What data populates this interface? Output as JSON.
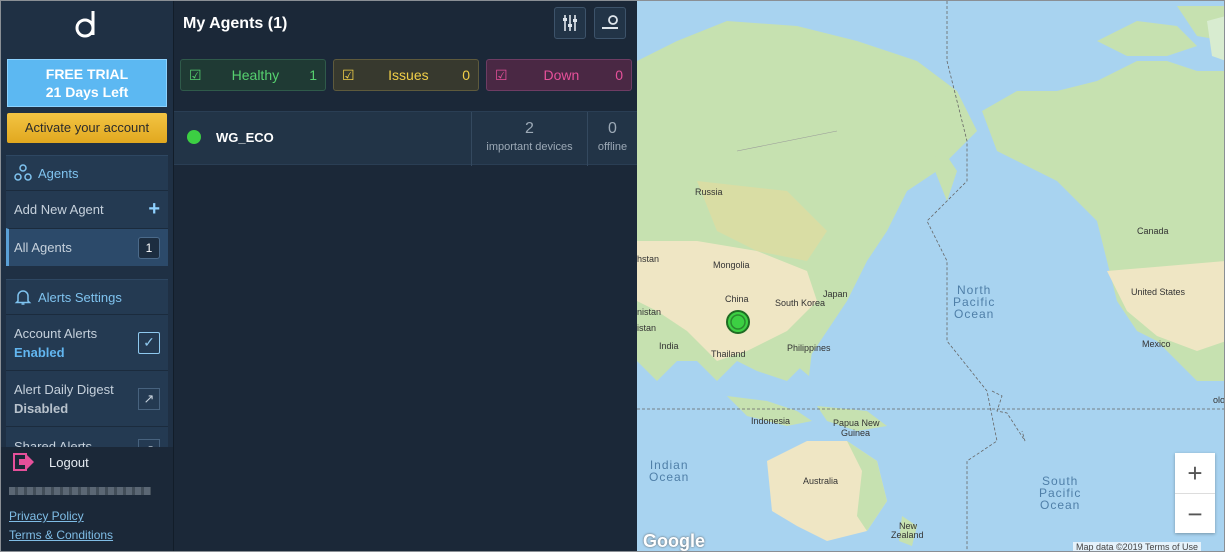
{
  "sidebar": {
    "trial": {
      "line1": "FREE TRIAL",
      "line2": "21 Days Left"
    },
    "activate_label": "Activate your account",
    "agents": {
      "header": "Agents",
      "add_label": "Add New Agent",
      "all_label": "All Agents",
      "all_count": "1"
    },
    "alerts": {
      "header": "Alerts Settings",
      "items": [
        {
          "title": "Account Alerts",
          "state": "Enabled"
        },
        {
          "title": "Alert Daily Digest",
          "state": "Disabled"
        },
        {
          "title": "Shared Alerts"
        }
      ]
    },
    "logout_label": "Logout",
    "links": {
      "privacy": "Privacy Policy",
      "terms": "Terms & Conditions"
    }
  },
  "main": {
    "title": "My Agents (1)",
    "statuses": [
      {
        "label": "Healthy",
        "count": "1",
        "color": "#56d16f"
      },
      {
        "label": "Issues",
        "count": "0",
        "color": "#f1cf48"
      },
      {
        "label": "Down",
        "count": "0",
        "color": "#e6509a"
      }
    ],
    "agents": [
      {
        "name": "WG_ECO",
        "status_color": "#3ccf43",
        "important_devices": "2",
        "important_label": "important devices",
        "offline": "0",
        "offline_label": "offline"
      }
    ]
  },
  "map": {
    "labels": {
      "russia": "Russia",
      "mongolia": "Mongolia",
      "china": "China",
      "south_korea": "South Korea",
      "japan": "Japan",
      "india": "India",
      "thailand": "Thailand",
      "philippines": "Philippines",
      "indonesia": "Indonesia",
      "papua1": "Papua New",
      "papua2": "Guinea",
      "australia": "Australia",
      "nz1": "New",
      "nz2": "Zealand",
      "canada": "Canada",
      "usa": "United States",
      "mexico": "Mexico",
      "khstan": "hstan",
      "nistan": "nistan",
      "istan": "istan",
      "colon": "olo"
    },
    "oceans": {
      "north_pacific": [
        "North",
        "Pacific",
        "Ocean"
      ],
      "south_pacific": [
        "South",
        "Pacific",
        "Ocean"
      ],
      "indian": [
        "Indian",
        "Ocean"
      ]
    },
    "zoom_in": "+",
    "zoom_out": "−",
    "google": "Google",
    "attribution": "Map data ©2019   Terms of Use"
  }
}
